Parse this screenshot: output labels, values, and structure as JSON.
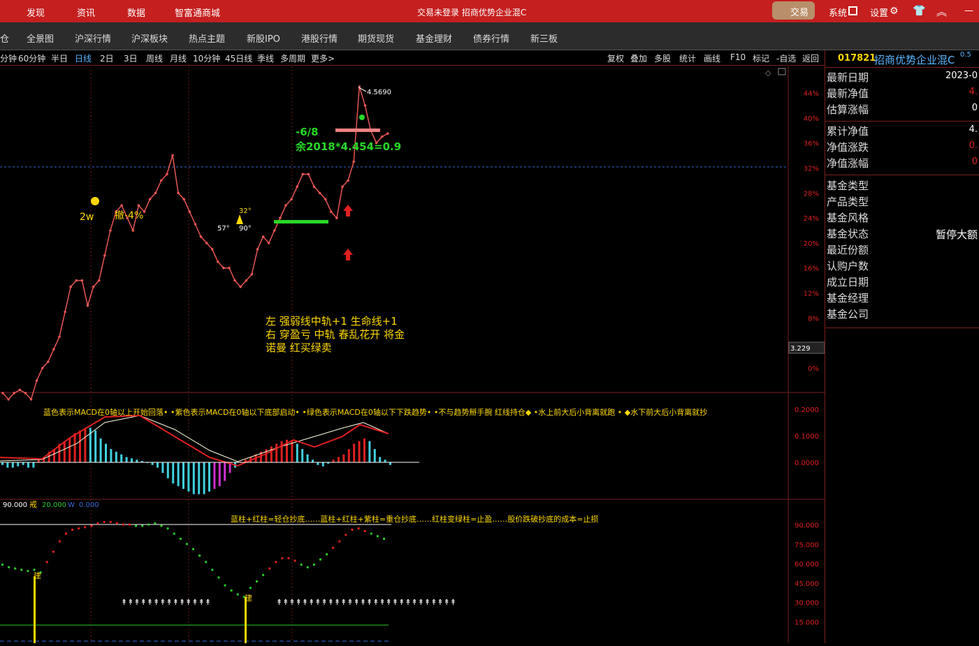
{
  "top": {
    "nav": [
      "发现",
      "资讯",
      "数据",
      "智富通商城"
    ],
    "center": "交易未登录  招商优势企业混C",
    "trade": "交易",
    "settings_labels": [
      "系统",
      "设置"
    ],
    "minimize": "—"
  },
  "nav2": [
    "仓",
    "全景图",
    "沪深行情",
    "沪深板块",
    "热点主题",
    "新股IPO",
    "港股行情",
    "期货现货",
    "基金理财",
    "债券行情",
    "新三板"
  ],
  "periods": [
    "分钟",
    "60分钟",
    "半日",
    "日线",
    "2日",
    "3日",
    "周线",
    "月线",
    "10分钟",
    "45日线",
    "季线",
    "多周期",
    "更多>"
  ],
  "active_period": "日线",
  "right_tools": [
    "复权",
    "叠加",
    "多股",
    "统计",
    "画线",
    "F10",
    "标记",
    "-自选",
    "返回"
  ],
  "side": {
    "code": "017821",
    "name": "招商优势企业混C",
    "sup": "0.5",
    "rows1": [
      {
        "label": "最新日期",
        "value": "2023-0"
      },
      {
        "label": "最新净值",
        "value": "4."
      },
      {
        "label": "估算涨幅",
        "value": "0"
      }
    ],
    "rows2": [
      {
        "label": "累计净值",
        "value": "4."
      },
      {
        "label": "净值涨跌",
        "value": "0."
      },
      {
        "label": "净值涨幅",
        "value": "0"
      }
    ],
    "rows3": [
      {
        "label": "基金类型",
        "value": ""
      },
      {
        "label": "产品类型",
        "value": ""
      },
      {
        "label": "基金风格",
        "value": ""
      },
      {
        "label": "基金状态",
        "value": "暂停大额"
      },
      {
        "label": "最近份额",
        "value": ""
      },
      {
        "label": "认购户数",
        "value": ""
      },
      {
        "label": "成立日期",
        "value": ""
      },
      {
        "label": "基金经理",
        "value": ""
      },
      {
        "label": "基金公司",
        "value": ""
      }
    ]
  },
  "annotations": {
    "ann_68": "-6/8",
    "ann_yu": "余2018*4.454=0.9",
    "ann_2w": "2w",
    "ann_che": "撤-4%",
    "ann_32": "32°",
    "ann_57": "57°",
    "ann_90": "90°",
    "note1": "左 强弱线中轨+1 生命线+1",
    "note2": "右 穿盈亏 中轨 春乱花开 将金",
    "note3": "诺曼    红买绿卖",
    "macd_legend": "蓝色表示MACD在0轴以上开始回落• •紫色表示MACD在0轴以下底部启动• •绿色表示MACD在0轴以下下跌趋势• •不与趋势掰手腕 红线持仓◆ •水上前大后小背离就跑 • ◆水下前大后小背离就抄",
    "kdj_legend": "蓝柱+红柱=轻仓抄底……蓝柱+红柱+紫柱=重仓抄底……红柱变绿柱=止盈……股价跌破抄底的成本=止损",
    "kdj_v1": "90.000",
    "kdj_label": "戒",
    "kdj_v2": "20.000",
    "kdj_label3": "W",
    "kdj_v3": "0.000",
    "jian": "建",
    "high_label": "4.5690",
    "price_box": "3.229"
  },
  "chart_data": [
    {
      "type": "line",
      "title": "",
      "y_unit": "%",
      "y_ticks": [
        "44%",
        "40%",
        "36%",
        "32%",
        "28%",
        "24%",
        "20%",
        "16%",
        "12%",
        "8%",
        "0%"
      ],
      "values": [
        -4,
        -5,
        -4,
        -3.5,
        -4,
        -5,
        -2,
        0,
        1,
        3,
        5,
        9,
        13,
        14,
        14,
        10,
        13,
        14,
        18,
        22,
        25,
        26,
        24,
        22,
        26,
        25,
        27,
        28,
        30,
        31,
        34,
        28,
        27,
        25,
        23,
        21,
        20,
        19,
        17,
        16,
        16,
        14,
        13,
        14,
        15,
        19,
        21,
        20,
        22,
        24,
        26,
        27,
        29,
        31,
        31,
        29,
        28,
        27,
        25,
        24,
        29,
        30,
        33,
        45,
        42,
        38,
        36,
        37,
        37.5
      ],
      "line_color": "#e85555",
      "highlight_x": 63,
      "highlight_value": "4.5690"
    },
    {
      "type": "bar",
      "title": "MACD",
      "y_ticks": [
        "0.2000",
        "0.1000",
        "0.0000"
      ],
      "ylim": [
        -0.13,
        0.25
      ]
    },
    {
      "type": "bar",
      "title": "KDJ",
      "y_ticks": [
        "90.000",
        "75.000",
        "60.000",
        "45.000",
        "30.000",
        "15.000"
      ],
      "ylim": [
        0,
        100
      ]
    }
  ],
  "colors": {
    "up": "#e02020",
    "down": "#40d0e0",
    "purple": "#d030d0",
    "green": "#28c828",
    "yellow": "#ffd800",
    "red_bar": "#c51f1f"
  }
}
